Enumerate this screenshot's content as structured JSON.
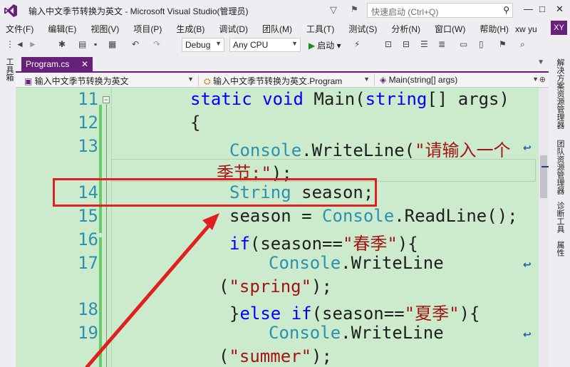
{
  "titlebar": {
    "title": "输入中文季节转换为英文 - Microsoft Visual Studio(管理员)",
    "quicklaunch_placeholder": "快速启动 (Ctrl+Q)",
    "minimize": "—",
    "maximize": "□",
    "close": "✕"
  },
  "menu": {
    "items": [
      "文件(F)",
      "编辑(E)",
      "视图(V)",
      "项目(P)",
      "生成(B)",
      "调试(D)",
      "团队(M)",
      "工具(T)",
      "测试(S)",
      "分析(N)",
      "窗口(W)",
      "帮助(H)"
    ],
    "user_name": "xw yu",
    "user_initials": "XY"
  },
  "toolbar": {
    "config": "Debug",
    "platform": "Any CPU",
    "start_label": "启动"
  },
  "left_strip": {
    "toolbox": "工具箱"
  },
  "right_strip": {
    "solution_explorer": "解决方案资源管理器",
    "team_explorer": "团队资源管理器",
    "diagnostics": "诊断工具",
    "properties": "属性"
  },
  "tabs": {
    "active": "Program.cs",
    "close": "✕"
  },
  "navbar": {
    "project": "输入中文季节转换为英文",
    "type": "输入中文季节转换为英文.Program",
    "member": "Main(string[] args)"
  },
  "code": {
    "line_numbers": [
      "11",
      "12",
      "13",
      "14",
      "15",
      "16",
      "17",
      "18",
      "19"
    ],
    "l11_static": "static",
    "l11_void": "void",
    "l11_main": "Main(",
    "l11_string": "string",
    "l11_rest": "[] args)",
    "l12": "{",
    "l13_console": "Console",
    "l13_method": ".WriteLine(",
    "l13_str": "\"请输入一个",
    "l13b_str": "季节:\"",
    "l13b_end": ");",
    "l14_type": "String",
    "l14_rest": " season;",
    "l15_a": "season = ",
    "l15_console": "Console",
    "l15_b": ".ReadLine();",
    "l16_if": "if",
    "l16_a": "(season==",
    "l16_str": "\"春季\"",
    "l16_b": "){",
    "l17_console": "Console",
    "l17_method": ".WriteLine",
    "l17b_a": "(",
    "l17b_str": "\"spring\"",
    "l17b_b": ");",
    "l18_a": "}",
    "l18_else": "else",
    "l18_if": "if",
    "l18_b": "(season==",
    "l18_str": "\"夏季\"",
    "l18_c": "){",
    "l19_console": "Console",
    "l19_method": ".WriteLine",
    "l19b_a": "(",
    "l19b_str": "\"summer\"",
    "l19b_b": ");"
  },
  "colors": {
    "accent": "#68217a",
    "editor_bg": "#ccebcc",
    "keyword": "#0000ff",
    "type": "#2b91af",
    "string": "#a31515",
    "annotation": "#e02020"
  }
}
